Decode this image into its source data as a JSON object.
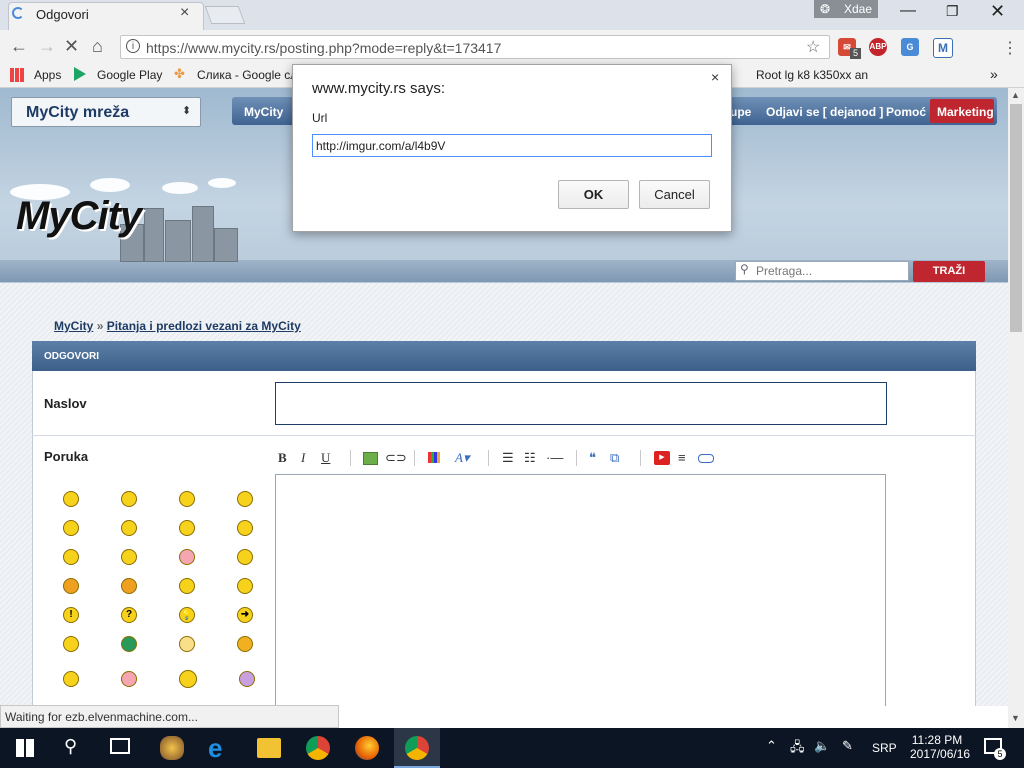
{
  "browser": {
    "tab_title": "Odgovori",
    "profile_name": "Xdae",
    "url": "https://www.mycity.rs/posting.php?mode=reply&t=173417",
    "extension_badge": "5",
    "bookmarks": [
      "Apps",
      "Google Play",
      "Слика - Google сл",
      "Root lg k8 k350xx an"
    ],
    "bookmark_overflow": "»"
  },
  "site": {
    "network_select": "MyCity mreža",
    "nav_items": [
      "MyCity",
      "upe",
      "Odjavi se [ dejanod ]",
      "Pomoć",
      "Marketing"
    ],
    "logo_text": "MyCity",
    "search_placeholder": "Pretraga...",
    "search_button": "TRAŽI",
    "breadcrumb": [
      "MyCity",
      "»",
      "Pitanja i predlozi vezani za MyCity"
    ],
    "form_header": "ODGOVORI",
    "subject_label": "Naslov",
    "message_label": "Poruka",
    "editor_tools": [
      "B",
      "I",
      "U",
      "image",
      "link",
      "color",
      "font",
      "bullets",
      "numbered",
      "hr",
      "quote",
      "code",
      "youtube",
      "align",
      "spoiler"
    ]
  },
  "dialog": {
    "title": "www.mycity.rs says:",
    "message": "Url",
    "input_value": "http://imgur.com/a/l4b9V",
    "ok_label": "OK",
    "cancel_label": "Cancel",
    "close_glyph": "×"
  },
  "status_bar": "Waiting for ezb.elvenmachine.com...",
  "taskbar": {
    "time": "11:28 PM",
    "date": "2017/06/16",
    "language": "SRP",
    "notification_count": "5"
  },
  "colors": {
    "accent_red": "#c0262f",
    "nav_blue": "#3f6392",
    "focus_blue": "#4d90fe"
  }
}
